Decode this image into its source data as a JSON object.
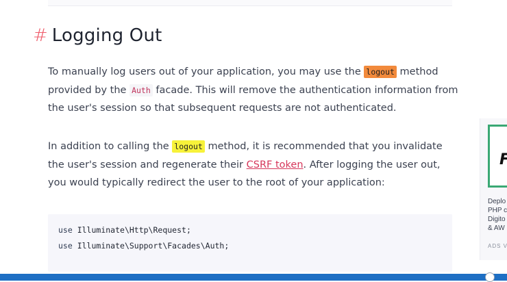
{
  "heading": {
    "hash": "#",
    "title": "Logging Out"
  },
  "para1": {
    "t1": "To manually log users out of your application, you may use the ",
    "code_logout": "logout",
    "t2": " method provided by the ",
    "code_auth": "Auth",
    "t3": " facade. This will remove the authentication information from the user's session so that subsequent requests are not authenticated."
  },
  "para2": {
    "t1": "In addition to calling the ",
    "code_logout": "logout",
    "t2": " method, it is recommended that you invalidate the user's session and regenerate their ",
    "link": "CSRF token",
    "t3": ". After logging the user out, you would typically redirect the user to the root of your application:"
  },
  "code": {
    "line1_kw": "use",
    "line1_rest": " Illuminate\\Http\\Request;",
    "line2_kw": "use",
    "line2_rest": " Illuminate\\Support\\Facades\\Auth;"
  },
  "ad": {
    "glyph": "F",
    "lines": [
      "Deplo",
      "PHP c",
      "Digito",
      "& AW"
    ],
    "label": "ADS V"
  },
  "colors": {
    "accent_hash": "#ef5b6a",
    "link": "#d6365a",
    "highlight_orange": "#f28a3c",
    "highlight_yellow": "#f7f23a",
    "taskbar": "#1e6fc4"
  }
}
